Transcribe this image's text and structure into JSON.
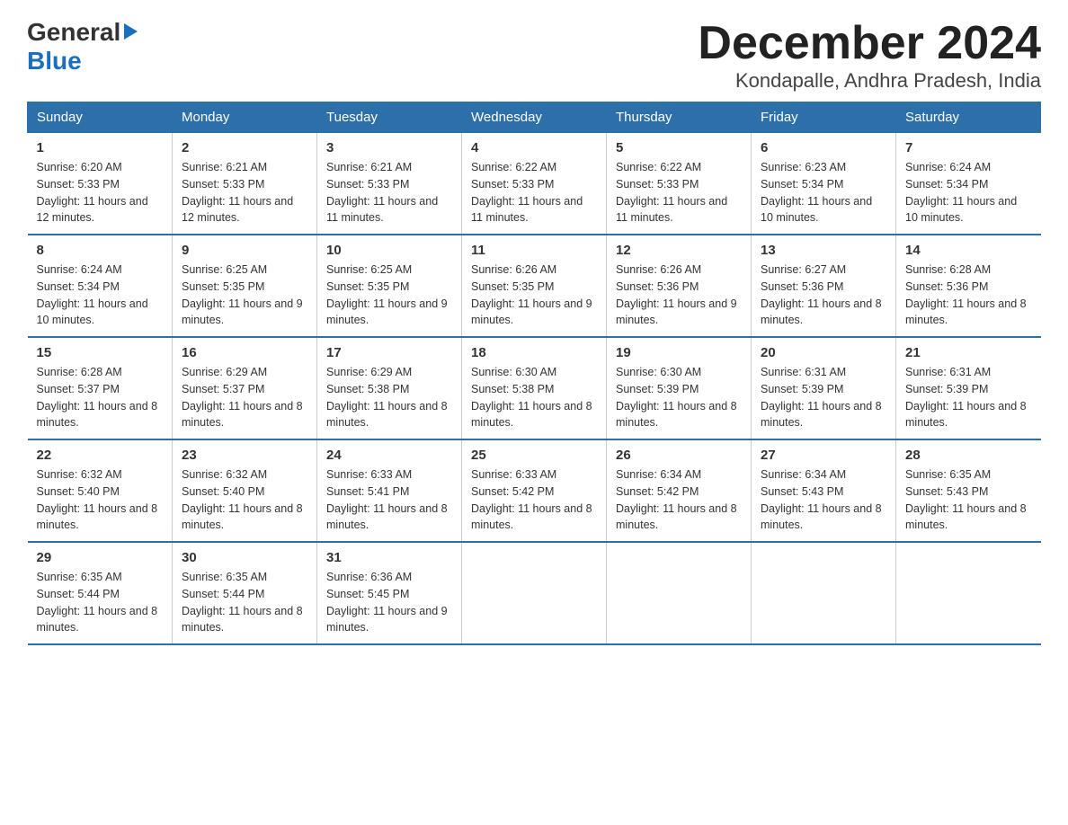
{
  "header": {
    "logo_general": "General",
    "logo_blue": "Blue",
    "title": "December 2024",
    "subtitle": "Kondapalle, Andhra Pradesh, India"
  },
  "columns": [
    "Sunday",
    "Monday",
    "Tuesday",
    "Wednesday",
    "Thursday",
    "Friday",
    "Saturday"
  ],
  "weeks": [
    [
      {
        "day": "1",
        "sunrise": "6:20 AM",
        "sunset": "5:33 PM",
        "daylight": "11 hours and 12 minutes."
      },
      {
        "day": "2",
        "sunrise": "6:21 AM",
        "sunset": "5:33 PM",
        "daylight": "11 hours and 12 minutes."
      },
      {
        "day": "3",
        "sunrise": "6:21 AM",
        "sunset": "5:33 PM",
        "daylight": "11 hours and 11 minutes."
      },
      {
        "day": "4",
        "sunrise": "6:22 AM",
        "sunset": "5:33 PM",
        "daylight": "11 hours and 11 minutes."
      },
      {
        "day": "5",
        "sunrise": "6:22 AM",
        "sunset": "5:33 PM",
        "daylight": "11 hours and 11 minutes."
      },
      {
        "day": "6",
        "sunrise": "6:23 AM",
        "sunset": "5:34 PM",
        "daylight": "11 hours and 10 minutes."
      },
      {
        "day": "7",
        "sunrise": "6:24 AM",
        "sunset": "5:34 PM",
        "daylight": "11 hours and 10 minutes."
      }
    ],
    [
      {
        "day": "8",
        "sunrise": "6:24 AM",
        "sunset": "5:34 PM",
        "daylight": "11 hours and 10 minutes."
      },
      {
        "day": "9",
        "sunrise": "6:25 AM",
        "sunset": "5:35 PM",
        "daylight": "11 hours and 9 minutes."
      },
      {
        "day": "10",
        "sunrise": "6:25 AM",
        "sunset": "5:35 PM",
        "daylight": "11 hours and 9 minutes."
      },
      {
        "day": "11",
        "sunrise": "6:26 AM",
        "sunset": "5:35 PM",
        "daylight": "11 hours and 9 minutes."
      },
      {
        "day": "12",
        "sunrise": "6:26 AM",
        "sunset": "5:36 PM",
        "daylight": "11 hours and 9 minutes."
      },
      {
        "day": "13",
        "sunrise": "6:27 AM",
        "sunset": "5:36 PM",
        "daylight": "11 hours and 8 minutes."
      },
      {
        "day": "14",
        "sunrise": "6:28 AM",
        "sunset": "5:36 PM",
        "daylight": "11 hours and 8 minutes."
      }
    ],
    [
      {
        "day": "15",
        "sunrise": "6:28 AM",
        "sunset": "5:37 PM",
        "daylight": "11 hours and 8 minutes."
      },
      {
        "day": "16",
        "sunrise": "6:29 AM",
        "sunset": "5:37 PM",
        "daylight": "11 hours and 8 minutes."
      },
      {
        "day": "17",
        "sunrise": "6:29 AM",
        "sunset": "5:38 PM",
        "daylight": "11 hours and 8 minutes."
      },
      {
        "day": "18",
        "sunrise": "6:30 AM",
        "sunset": "5:38 PM",
        "daylight": "11 hours and 8 minutes."
      },
      {
        "day": "19",
        "sunrise": "6:30 AM",
        "sunset": "5:39 PM",
        "daylight": "11 hours and 8 minutes."
      },
      {
        "day": "20",
        "sunrise": "6:31 AM",
        "sunset": "5:39 PM",
        "daylight": "11 hours and 8 minutes."
      },
      {
        "day": "21",
        "sunrise": "6:31 AM",
        "sunset": "5:39 PM",
        "daylight": "11 hours and 8 minutes."
      }
    ],
    [
      {
        "day": "22",
        "sunrise": "6:32 AM",
        "sunset": "5:40 PM",
        "daylight": "11 hours and 8 minutes."
      },
      {
        "day": "23",
        "sunrise": "6:32 AM",
        "sunset": "5:40 PM",
        "daylight": "11 hours and 8 minutes."
      },
      {
        "day": "24",
        "sunrise": "6:33 AM",
        "sunset": "5:41 PM",
        "daylight": "11 hours and 8 minutes."
      },
      {
        "day": "25",
        "sunrise": "6:33 AM",
        "sunset": "5:42 PM",
        "daylight": "11 hours and 8 minutes."
      },
      {
        "day": "26",
        "sunrise": "6:34 AM",
        "sunset": "5:42 PM",
        "daylight": "11 hours and 8 minutes."
      },
      {
        "day": "27",
        "sunrise": "6:34 AM",
        "sunset": "5:43 PM",
        "daylight": "11 hours and 8 minutes."
      },
      {
        "day": "28",
        "sunrise": "6:35 AM",
        "sunset": "5:43 PM",
        "daylight": "11 hours and 8 minutes."
      }
    ],
    [
      {
        "day": "29",
        "sunrise": "6:35 AM",
        "sunset": "5:44 PM",
        "daylight": "11 hours and 8 minutes."
      },
      {
        "day": "30",
        "sunrise": "6:35 AM",
        "sunset": "5:44 PM",
        "daylight": "11 hours and 8 minutes."
      },
      {
        "day": "31",
        "sunrise": "6:36 AM",
        "sunset": "5:45 PM",
        "daylight": "11 hours and 9 minutes."
      },
      null,
      null,
      null,
      null
    ]
  ]
}
